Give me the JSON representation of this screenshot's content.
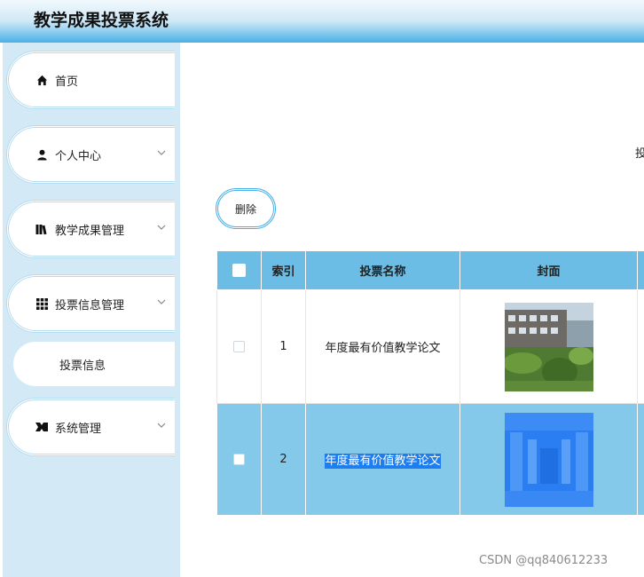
{
  "app": {
    "title": "教学成果投票系统"
  },
  "sidebar": {
    "items": [
      {
        "label": "首页",
        "icon": "home-icon"
      },
      {
        "label": "个人中心",
        "icon": "user-icon"
      },
      {
        "label": "教学成果管理",
        "icon": "books-icon"
      },
      {
        "label": "投票信息管理",
        "icon": "grid-icon"
      },
      {
        "label": "投票信息"
      },
      {
        "label": "系统管理",
        "icon": "system-icon"
      }
    ]
  },
  "main": {
    "truncated_title": "投",
    "delete_label": "删除",
    "table": {
      "headers": [
        "索引",
        "投票名称",
        "封面"
      ],
      "rows": [
        {
          "index": "1",
          "name": "年度最有价值教学论文",
          "cover": "campus-photo",
          "selected": false
        },
        {
          "index": "2",
          "name": "年度最有价值教学论文",
          "cover": "library-photo",
          "selected": true
        }
      ]
    }
  },
  "watermark": "CSDN @qq840612233",
  "colors": {
    "accent": "#49b1e6",
    "header": "#6bbde5",
    "sidebar": "#d3eaf6",
    "selected_row": "#84c8ea"
  }
}
